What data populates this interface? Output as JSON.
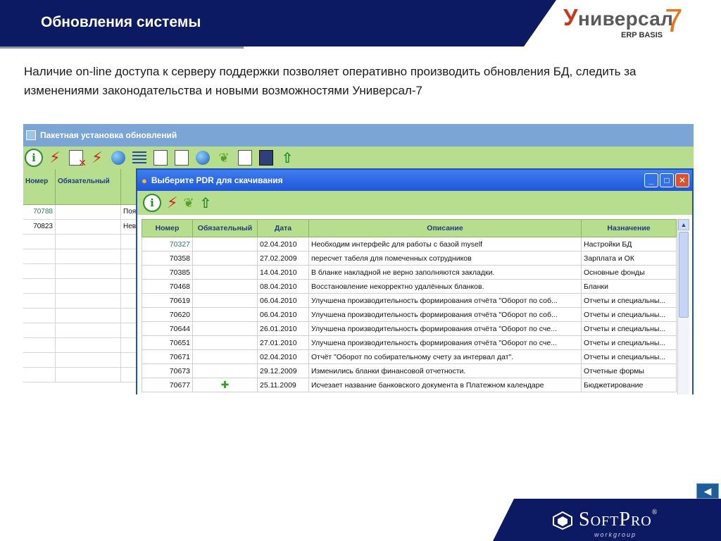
{
  "header": {
    "title": "Обновления системы",
    "logo_first": "У",
    "logo_rest": "ниверсал",
    "logo_version": "7",
    "logo_subtitle": "ERP BASIS"
  },
  "intro": "Наличие on-line доступа к серверу поддержки позволяет оперативно производить обновления БД, следить за изменениями законодательства и новыми возможностями Универсал-7",
  "batch_window": {
    "title": "Пакетная установка обновлений",
    "columns": [
      "Номер",
      "Обязательный"
    ],
    "rows": [
      {
        "num": "70788",
        "desc": "Поя"
      },
      {
        "num": "70823",
        "desc": "Нев"
      }
    ]
  },
  "dialog": {
    "title": "Выберите PDR для скачивания",
    "columns": {
      "num": "Номер",
      "req": "Обязательный",
      "date": "Дата",
      "desc": "Описание",
      "purpose": "Назначение"
    },
    "rows": [
      {
        "num": "70327",
        "date": "02.04.2010",
        "desc": "Необходим интерфейс для работы с базой myself",
        "purpose": "Настройки БД"
      },
      {
        "num": "70358",
        "date": "27.02.2009",
        "desc": "пересчет табеля для помеченных сотрудников",
        "purpose": "Зарплата и ОК"
      },
      {
        "num": "70385",
        "date": "14.04.2010",
        "desc": "В бланке накладной не верно заполняются закладки.",
        "purpose": "Основные фонды"
      },
      {
        "num": "70468",
        "date": "08.04.2010",
        "desc": "Восстановление некорректно удалённых бланков.",
        "purpose": "Бланки"
      },
      {
        "num": "70619",
        "date": "06.04.2010",
        "desc": "Улучшена производительность формирования отчёта \"Оборот по соб...",
        "purpose": "Отчеты и специальны..."
      },
      {
        "num": "70620",
        "date": "06.04.2010",
        "desc": "Улучшена производительность формирования отчёта \"Оборот по соб...",
        "purpose": "Отчеты и специальны..."
      },
      {
        "num": "70644",
        "date": "26.01.2010",
        "desc": "Улучшена производительность формирования отчёта \"Оборот по сче...",
        "purpose": "Отчеты и специальны..."
      },
      {
        "num": "70651",
        "date": "27.01.2010",
        "desc": "Улучшена производительность формирования отчёта \"Оборот по сче...",
        "purpose": "Отчеты и специальны..."
      },
      {
        "num": "70671",
        "date": "02.04.2010",
        "desc": "Отчёт \"Оборот по собирательному счету за интервал дат\".",
        "purpose": "Отчеты и специальны..."
      },
      {
        "num": "70673",
        "date": "29.12.2009",
        "desc": "Изменились бланки финансовой отчетности.",
        "purpose": "Отчетные формы"
      },
      {
        "num": "70677",
        "date": "25.11.2009",
        "desc": "Исчезает название банковского документа в Платежном календаре",
        "purpose": "Бюджетирование"
      }
    ]
  },
  "footer": {
    "brand_s": "S",
    "brand_oft": "OFT",
    "brand_p": "P",
    "brand_ro": "RO",
    "brand_reg": "®",
    "brand_sub": "workgroup"
  },
  "icons": {
    "info": "i",
    "bolt": "⚡",
    "plus": "✚",
    "up": "⇧",
    "minimize": "_",
    "maximize": "□",
    "close": "✕",
    "back": "◀",
    "scroll_up": "▲"
  }
}
